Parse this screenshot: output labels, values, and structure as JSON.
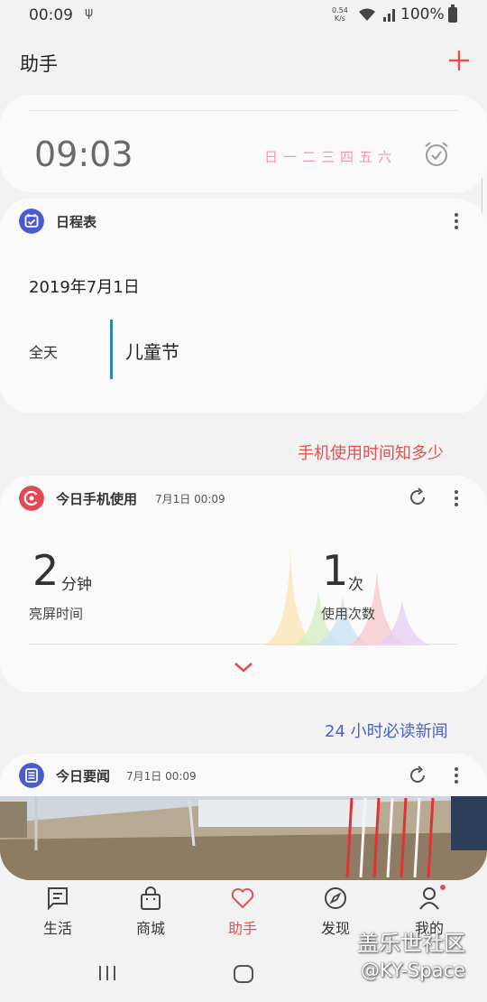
{
  "status_bar": {
    "time": "00:09",
    "net_speed_value": "0.54",
    "net_speed_unit": "K/s",
    "network_type": "4G",
    "battery": "100%"
  },
  "header": {
    "title": "助手"
  },
  "alarm": {
    "time": "09:03",
    "days": "日一二三四五六"
  },
  "schedule": {
    "title": "日程表",
    "date": "2019年7月1日",
    "all_day": "全天",
    "event": "儿童节"
  },
  "usage_link": "手机使用时间知多少",
  "usage": {
    "title": "今日手机使用",
    "timestamp": "7月1日 00:09",
    "screen_time_value": "2",
    "screen_time_unit": "分钟",
    "screen_time_label": "亮屏时间",
    "unlock_value": "1",
    "unlock_unit": "次",
    "unlock_label": "使用次数"
  },
  "news_link": "24 小时必读新闻",
  "news": {
    "title": "今日要闻",
    "timestamp": "7月1日 00:09"
  },
  "bottom_nav": [
    {
      "label": "生活",
      "icon": "bookmark-flag-icon"
    },
    {
      "label": "商城",
      "icon": "shopping-bag-icon"
    },
    {
      "label": "助手",
      "icon": "heart-icon",
      "active": true
    },
    {
      "label": "发现",
      "icon": "compass-icon"
    },
    {
      "label": "我的",
      "icon": "person-icon"
    }
  ],
  "watermark": {
    "line1": "盖乐世社区",
    "line2": "@KY-Space"
  },
  "colors": {
    "accent_red": "#e0524f",
    "news_blue": "#4b63c8",
    "schedule_icon": "#4a5bd0",
    "usage_icon": "#e04a55",
    "event_bar": "#2a8aa0"
  }
}
